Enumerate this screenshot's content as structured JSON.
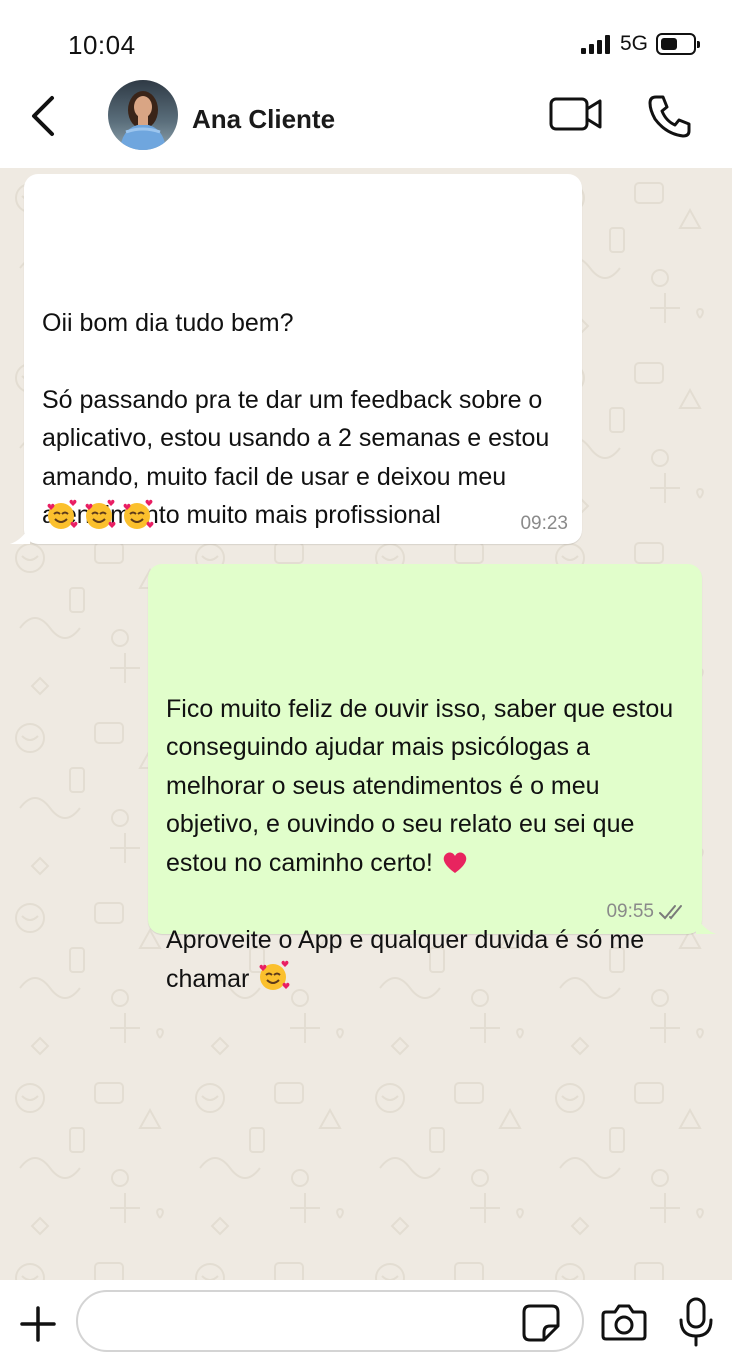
{
  "status_bar": {
    "time": "10:04",
    "network": "5G",
    "signal_bars": 4,
    "battery_level": 0.5
  },
  "header": {
    "contact_name": "Ana Cliente",
    "icons": [
      "back-chevron-icon",
      "avatar",
      "video-call-icon",
      "phone-icon"
    ]
  },
  "messages": [
    {
      "direction": "incoming",
      "text": "Oii bom dia tudo bem?\n\nSó passando pra te dar um feedback sobre o aplicativo, estou usando a 2 semanas e estou amando, muito facil de usar e deixou meu atendimento muito mais profissional",
      "emojis": [
        "smiling-face-with-hearts",
        "smiling-face-with-hearts",
        "smiling-face-with-hearts"
      ],
      "time": "09:23"
    },
    {
      "direction": "outgoing",
      "text": "Fico muito feliz de ouvir isso, saber que estou conseguindo ajudar mais psicólogas a melhorar o seus atendimentos é o meu objetivo, e ouvindo o seu relato eu sei que estou no caminho certo! ",
      "text2": "Aproveite o App e qualquer duvida é só me chamar ",
      "inline_emojis": [
        "red-heart",
        "smiling-face-with-hearts"
      ],
      "time": "09:55",
      "status": "read-double-check"
    }
  ],
  "input": {
    "placeholder": "",
    "value": ""
  },
  "colors": {
    "chat_background": "#efeae2",
    "incoming_bubble": "#ffffff",
    "outgoing_bubble": "#e1fecb",
    "timestamp": "#8a8a8a"
  }
}
